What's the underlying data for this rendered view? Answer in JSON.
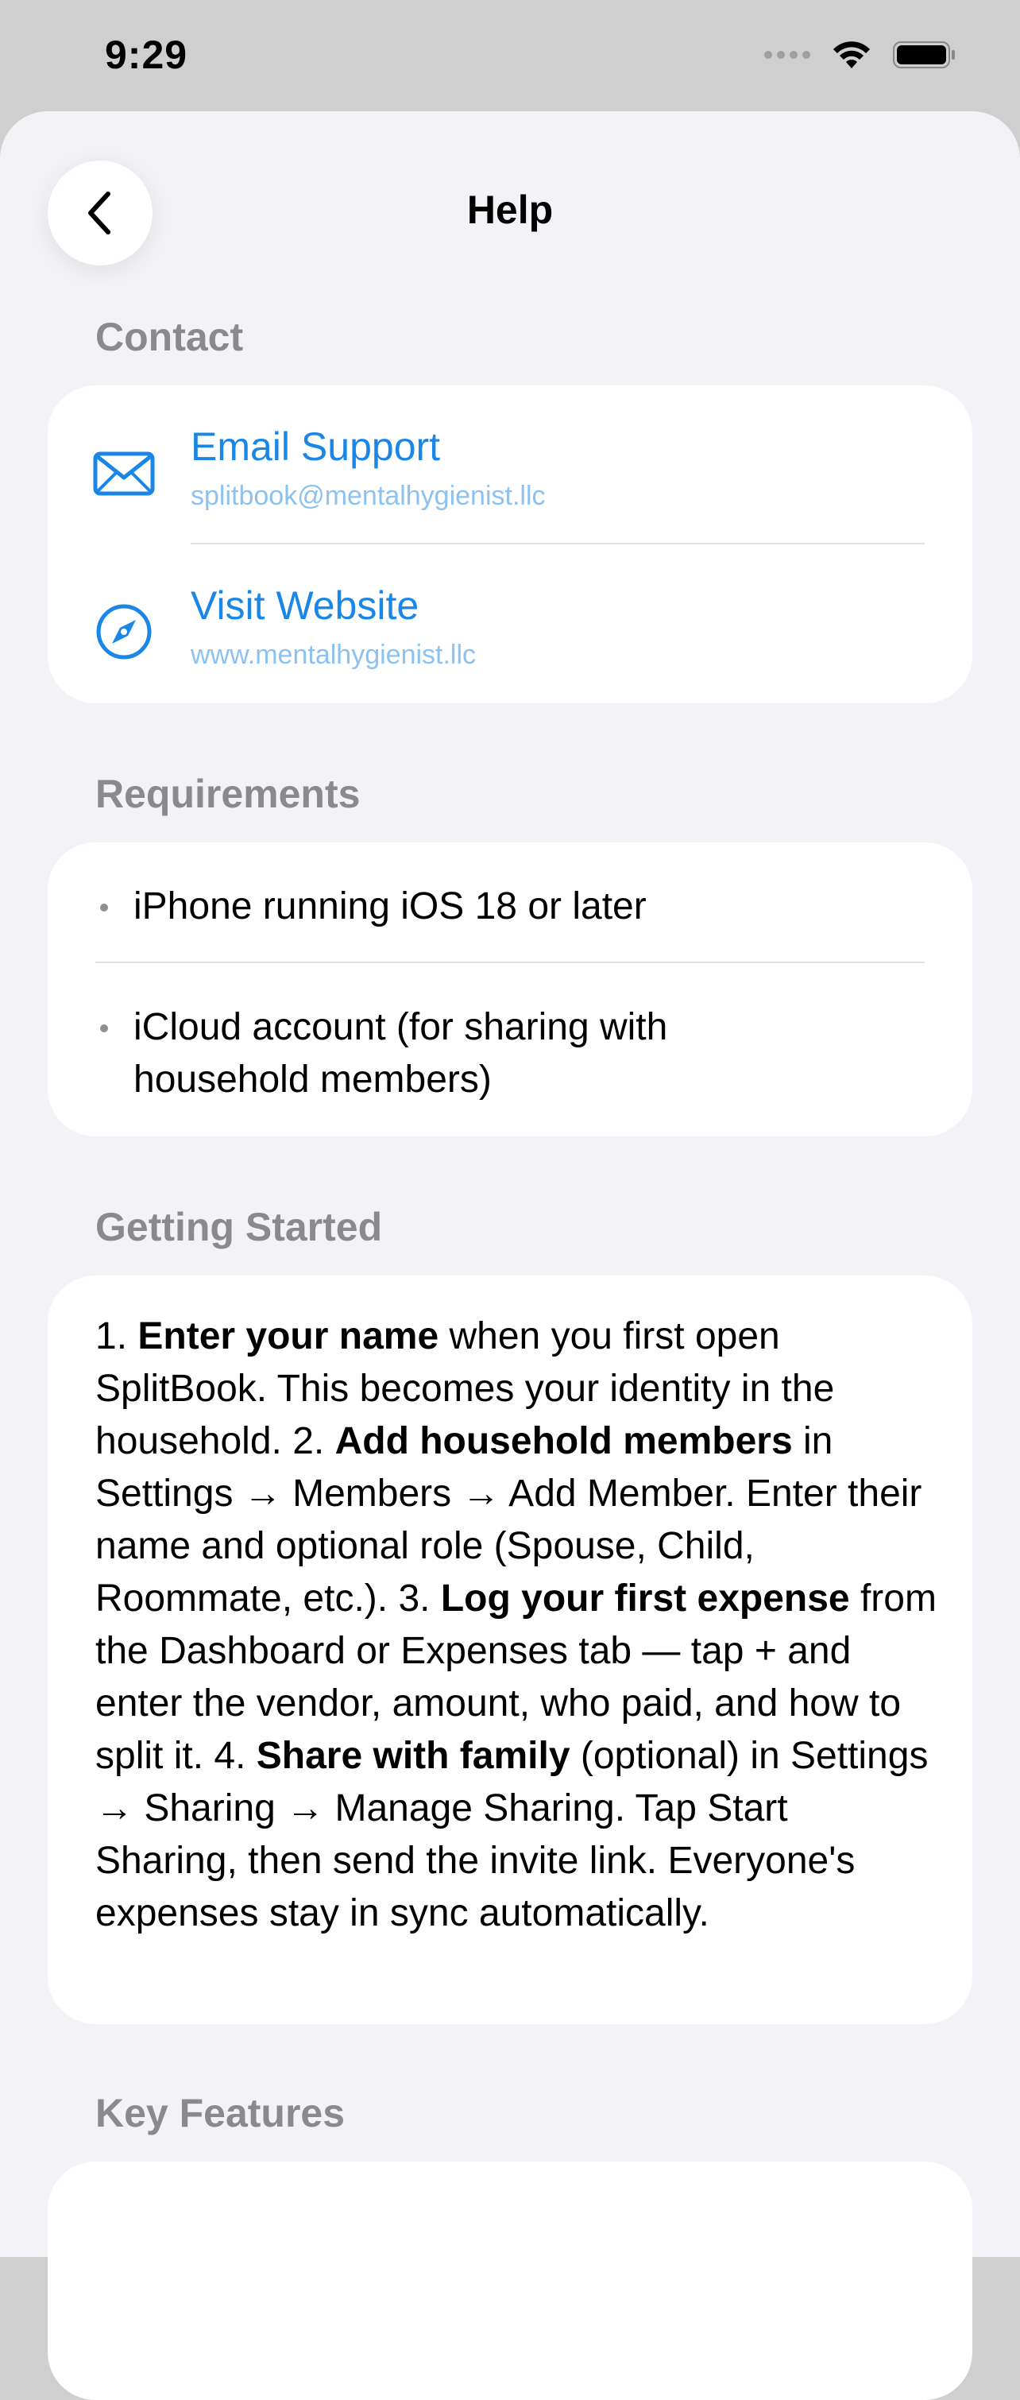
{
  "status_bar": {
    "time": "9:29",
    "icons": [
      "signal-icon",
      "wifi-icon",
      "battery-icon"
    ]
  },
  "nav": {
    "title": "Help",
    "back_icon": "chevron-left-icon"
  },
  "contact": {
    "header": "Contact",
    "items": [
      {
        "icon": "envelope-icon",
        "title": "Email Support",
        "subtitle": "splitbook@mentalhygienist.llc"
      },
      {
        "icon": "compass-icon",
        "title": "Visit Website",
        "subtitle": "www.mentalhygienist.llc"
      }
    ]
  },
  "requirements": {
    "header": "Requirements",
    "items": [
      "iPhone running iOS 18 or later",
      "iCloud account (for sharing with household members)"
    ]
  },
  "getting_started": {
    "header": "Getting Started",
    "steps": [
      {
        "num": "1. ",
        "bold": "Enter your name",
        "text": " when you first open SplitBook. This becomes your identity in the household. "
      },
      {
        "num": "2. ",
        "bold": "Add household members",
        "text": " in Settings → Members → Add Member. Enter their name and optional role (Spouse, Child, Roommate, etc.). "
      },
      {
        "num": "3. ",
        "bold": "Log your first expense",
        "text": " from the Dashboard or Expenses tab — tap + and enter the vendor, amount, who paid, and how to split it. "
      },
      {
        "num": "4. ",
        "bold": "Share with family",
        "text": " (optional) in Settings → Sharing → Manage Sharing. Tap Start Sharing, then send the invite link. Everyone's expenses stay in sync automatically."
      }
    ]
  },
  "key_features": {
    "header": "Key Features"
  },
  "colors": {
    "accent": "#1a86e6",
    "accent_light": "#8cc2f0",
    "background": "#f2f2f7",
    "section_header": "#8a8a8e"
  }
}
